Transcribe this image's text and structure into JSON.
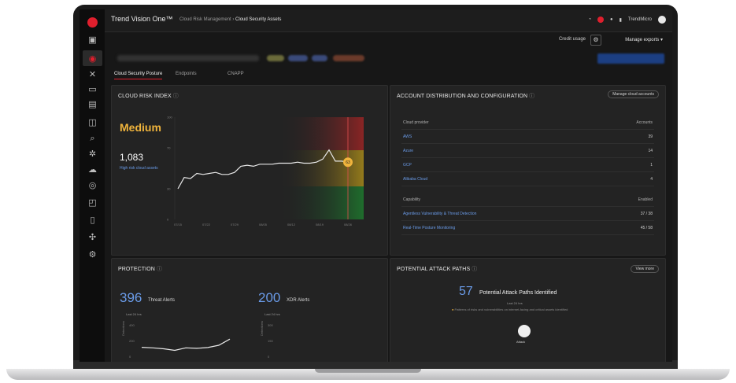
{
  "topbar": {
    "app_title": "Trend Vision One™",
    "crumb_parent": "Cloud Risk Management",
    "crumb_sep": "›",
    "crumb_current": "Cloud Security Assets",
    "user_name": "TrendMicro",
    "colors": {
      "brand": "#e01f2d",
      "accent_blue": "#6a9be8"
    }
  },
  "subbar": {
    "credit_usage": "Credit usage",
    "manage_exports": "Manage exports"
  },
  "tabs": [
    {
      "label": "Cloud Security Posture"
    },
    {
      "label": "Endpoints"
    },
    {
      "label": "CNAPP"
    }
  ],
  "risk_card": {
    "title": "CLOUD RISK INDEX",
    "level": "Medium",
    "count": "1,083",
    "link": "High risk cloud assets",
    "x_ticks": [
      "07/15",
      "07/22",
      "07/29",
      "08/05",
      "08/12",
      "08/19",
      "08/26"
    ],
    "y_ticks": [
      "100",
      "70",
      "30",
      "0"
    ],
    "marker_value": "63",
    "chart_data": {
      "type": "line",
      "ylim": [
        0,
        100
      ],
      "values": [
        30,
        41,
        40,
        45,
        44,
        45,
        46,
        44,
        44,
        46,
        52,
        53,
        52,
        54,
        54,
        54,
        55,
        55,
        55,
        56,
        55,
        55,
        56,
        59,
        68,
        57,
        57,
        56
      ]
    }
  },
  "account_card": {
    "title": "ACCOUNT DISTRIBUTION AND CONFIGURATION",
    "manage_button": "Manage cloud accounts",
    "providers_header": {
      "left": "Cloud provider",
      "right": "Accounts"
    },
    "providers": [
      {
        "name": "AWS",
        "count": "39"
      },
      {
        "name": "Azure",
        "count": "14"
      },
      {
        "name": "GCP",
        "count": "1"
      },
      {
        "name": "Alibaba Cloud",
        "count": "4"
      }
    ],
    "cap_header": {
      "left": "Capability",
      "right": "Enabled"
    },
    "capabilities": [
      {
        "name": "Agentless Vulnerability & Threat Detection",
        "value": "37 / 38"
      },
      {
        "name": "Real-Time Posture Monitoring",
        "value": "45 / 58"
      }
    ]
  },
  "protection_card": {
    "title": "PROTECTION",
    "threat_count": "396",
    "threat_label": "Threat Alerts",
    "threat_sub": "Last 24 hrs",
    "xdr_count": "200",
    "xdr_label": "XDR Alerts",
    "xdr_sub": "Last 24 hrs",
    "y_ticks_left": [
      "400",
      "200",
      "0"
    ],
    "y_ticks_right": [
      "300",
      "150",
      "0"
    ],
    "axis_label": "Detections",
    "chart_data": {
      "type": "line",
      "series": [
        {
          "values": [
            180,
            175,
            165,
            150,
            175,
            170,
            178,
            200,
            260
          ]
        }
      ],
      "ylim": [
        0,
        400
      ]
    }
  },
  "attack_card": {
    "title": "POTENTIAL ATTACK PATHS",
    "view_button": "View more",
    "count": "57",
    "headline": "Potential Attack Paths Identified",
    "sub": "Last 24 hrs",
    "note": "Patterns of risks and vulnerabilities on internet-facing and critical assets identified",
    "node_label": "Attack"
  }
}
